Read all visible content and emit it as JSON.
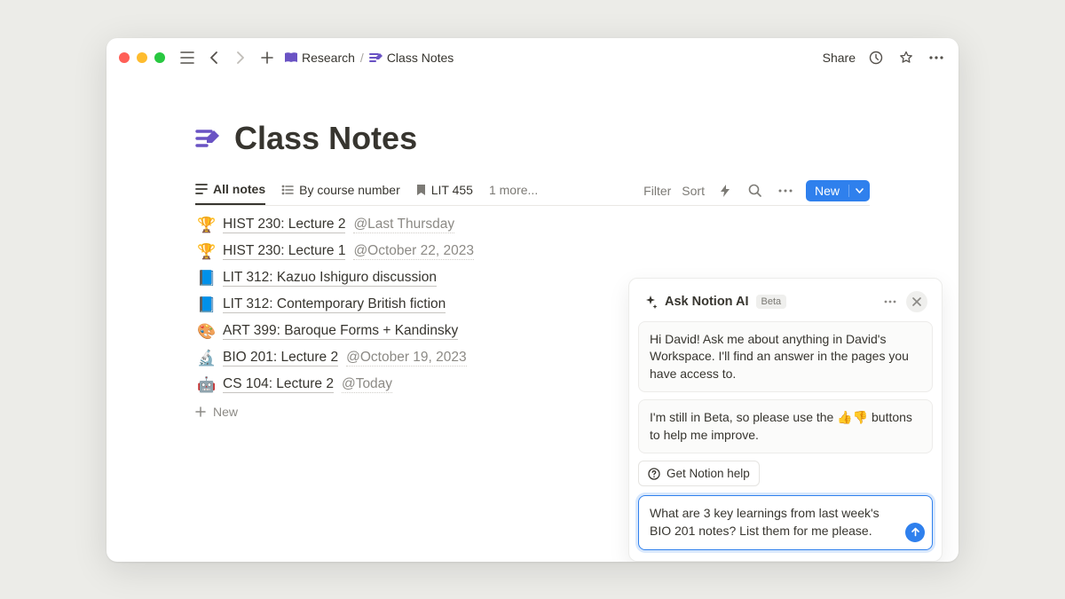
{
  "breadcrumb": {
    "parent": "Research",
    "page": "Class Notes"
  },
  "topbar": {
    "share": "Share"
  },
  "page": {
    "title": "Class Notes"
  },
  "tabs": {
    "all": "All notes",
    "bycourse": "By course number",
    "lit455": "LIT 455",
    "more": "1 more..."
  },
  "toolbar": {
    "filter": "Filter",
    "sort": "Sort",
    "new": "New"
  },
  "notes": [
    {
      "emoji": "🏆",
      "title": "HIST 230: Lecture 2",
      "date": "@Last Thursday"
    },
    {
      "emoji": "🏆",
      "title": "HIST 230: Lecture 1",
      "date": "@October 22, 2023"
    },
    {
      "emoji": "📘",
      "title": "LIT 312: Kazuo Ishiguro discussion",
      "date": ""
    },
    {
      "emoji": "📘",
      "title": "LIT 312: Contemporary British fiction",
      "date": ""
    },
    {
      "emoji": "🎨",
      "title": "ART 399: Baroque Forms + Kandinsky",
      "date": ""
    },
    {
      "emoji": "🔬",
      "title": "BIO 201: Lecture 2",
      "date": "@October 19, 2023"
    },
    {
      "emoji": "🤖",
      "title": "CS 104: Lecture 2",
      "date": "@Today"
    }
  ],
  "newrow": "New",
  "ai": {
    "title": "Ask Notion AI",
    "badge": "Beta",
    "msg1": "Hi David! Ask me about anything in David's Workspace. I'll find an answer in the pages you have access to.",
    "msg2_a": "I'm still in Beta, so please use the ",
    "msg2_b": " buttons to help me improve.",
    "help": "Get Notion help",
    "input": "What are 3 key learnings from last week's BIO 201 notes? List them for me please."
  }
}
